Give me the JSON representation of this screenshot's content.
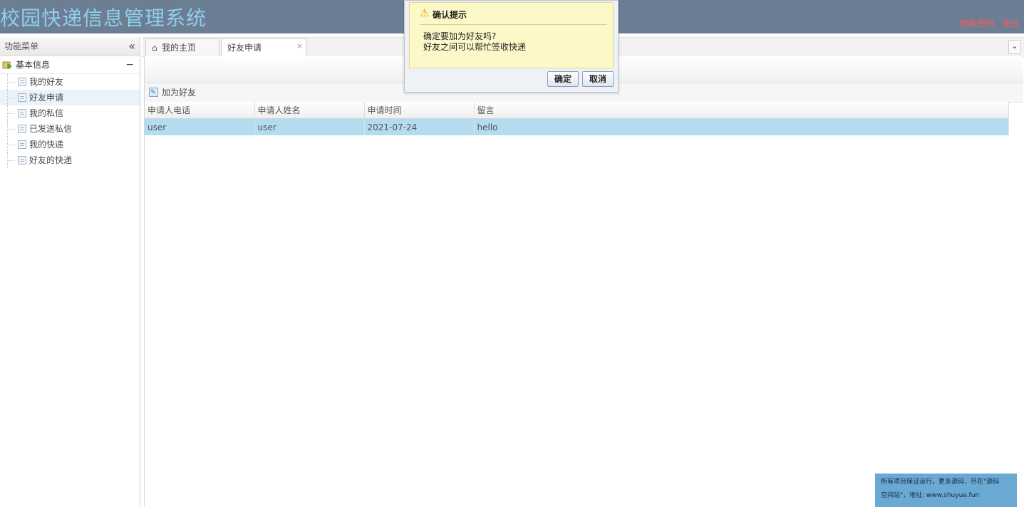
{
  "app": {
    "title": "校园快递信息管理系统",
    "links": {
      "change_password": "修改密码",
      "logout": "退出"
    }
  },
  "sidebar": {
    "title": "功能菜单",
    "group": {
      "label": "基本信息",
      "toggle": "−"
    },
    "items": [
      {
        "label": "我的好友"
      },
      {
        "label": "好友申请"
      },
      {
        "label": "我的私信"
      },
      {
        "label": "已发送私信"
      },
      {
        "label": "我的快递"
      },
      {
        "label": "好友的快递"
      }
    ]
  },
  "tabs": {
    "home": "我的主页",
    "active": "好友申请",
    "close": "×",
    "scroll": "⌄"
  },
  "toolbar": {
    "add_friend": "加为好友"
  },
  "table": {
    "headers": [
      "申请人电话",
      "申请人姓名",
      "申请时间",
      "留言"
    ],
    "rows": [
      {
        "phone": "user",
        "name": "user",
        "time": "2021-07-24",
        "message": "hello"
      }
    ]
  },
  "dialog": {
    "title": "确认提示",
    "line1": "确定要加为好友吗?",
    "line2": "好友之间可以帮忙签收快递",
    "ok": "确定",
    "cancel": "取消"
  },
  "footer": {
    "line1": "所有项目保证运行，更多源码，尽在\"源码",
    "line2": "空间站\"，地址: www.shuyue.fun"
  },
  "colors": {
    "header_bg": "#6c7e94",
    "title_color": "#8fd0ea",
    "link_color": "#ff5a5a",
    "selected_row": "#b3dcf0",
    "dialog_bg": "#fdf8c8"
  }
}
